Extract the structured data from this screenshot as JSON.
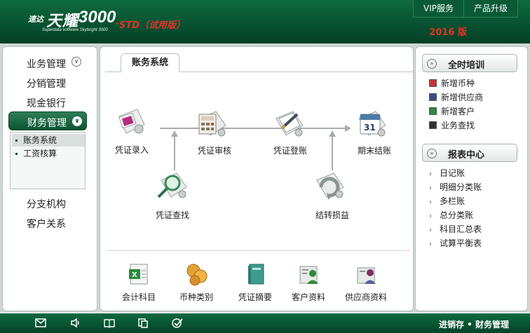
{
  "header": {
    "logo_small": "速达",
    "logo_name": "天耀",
    "logo_version": "3000",
    "logo_sub": "Superdata software Skybright 3000",
    "edition": "STD（试用版）",
    "edition_sep": "-",
    "vip": "VIP服务",
    "upgrade": "产品升级",
    "year": "2016 版"
  },
  "sidebar": {
    "items": [
      "业务管理",
      "分销管理",
      "现金银行",
      "财务管理",
      "分支机构",
      "客户关系"
    ],
    "submenu": [
      "账务系统",
      "工资核算"
    ]
  },
  "center": {
    "tab": "账务系统",
    "flow": [
      "凭证录入",
      "凭证审核",
      "凭证登账",
      "期末结账",
      "凭证查找",
      "结转损益"
    ],
    "calendar_day": "31",
    "bottom_tools": [
      "会计科目",
      "币种类别",
      "凭证摘要",
      "客户资料",
      "供应商资料"
    ]
  },
  "right": {
    "training_title": "全时培训",
    "training_items": [
      "新增币种",
      "新增供应商",
      "新增客户",
      "业务查找"
    ],
    "report_title": "报表中心",
    "report_items": [
      "日记账",
      "明细分类账",
      "多栏账",
      "总分类账",
      "科目汇总表",
      "试算平衡表"
    ]
  },
  "footer": {
    "icons": [
      "mail-icon",
      "sound-icon",
      "book-icon",
      "copy-icon",
      "check-icon"
    ],
    "text": "进销存 • 财务管理"
  },
  "colors": {
    "brand_green": "#075331",
    "accent_red": "#e3332c"
  }
}
